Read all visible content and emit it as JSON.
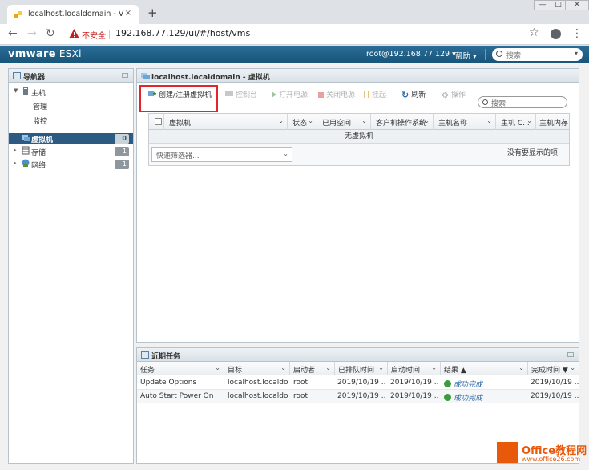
{
  "browser": {
    "tab_title": "localhost.localdomain - VMwa",
    "tab_close": "×",
    "new_tab": "+",
    "insecure_label": "不安全",
    "url": "192.168.77.129/ui/#/host/vms",
    "win_min": "—",
    "win_max": "□",
    "win_close": "✕"
  },
  "header": {
    "logo": "vmware",
    "product": "ESXi",
    "user": "root@192.168.77.129 ▾",
    "help": "帮助 ▾",
    "search_placeholder": "搜索",
    "dropdown": "▾"
  },
  "navigator": {
    "title": "导航器",
    "items": [
      {
        "label": "主机",
        "twisty": "▼"
      },
      {
        "label": "管理"
      },
      {
        "label": "监控"
      },
      {
        "label": "虚拟机",
        "badge": "0"
      },
      {
        "label": "存储",
        "badge": "1",
        "twisty": "▸"
      },
      {
        "label": "网络",
        "badge": "1",
        "twisty": "▸"
      }
    ]
  },
  "main": {
    "title": "localhost.localdomain - 虚拟机",
    "toolbar": {
      "create": "创建/注册虚拟机",
      "console": "控制台",
      "power_on": "打开电源",
      "power_off": "关闭电源",
      "suspend": "挂起",
      "refresh": "刷新",
      "actions": "操作",
      "search_placeholder": "搜索"
    },
    "columns": [
      "虚拟机",
      "状态",
      "已用空间",
      "客户机操作系统",
      "主机名称",
      "主机 C...",
      "主机内存"
    ],
    "empty": "无虚拟机",
    "filter_placeholder": "快速筛选器...",
    "no_items": "没有要显示的项",
    "sort_icon": "⌄"
  },
  "tasks": {
    "title": "近期任务",
    "columns": [
      "任务",
      "目标",
      "启动者",
      "已排队时间",
      "启动时间",
      "结果 ▲",
      "完成时间 ▼"
    ],
    "rows": [
      [
        "Update Options",
        "localhost.localdo...",
        "root",
        "2019/10/19 ...",
        "2019/10/19 ...",
        "成功完成",
        "2019/10/19 ..."
      ],
      [
        "Auto Start Power On",
        "localhost.localdo...",
        "root",
        "2019/10/19 ...",
        "2019/10/19 ...",
        "成功完成",
        "2019/10/19 ..."
      ]
    ]
  },
  "watermark": {
    "title": "Office教程网",
    "url": "www.office26.com"
  }
}
